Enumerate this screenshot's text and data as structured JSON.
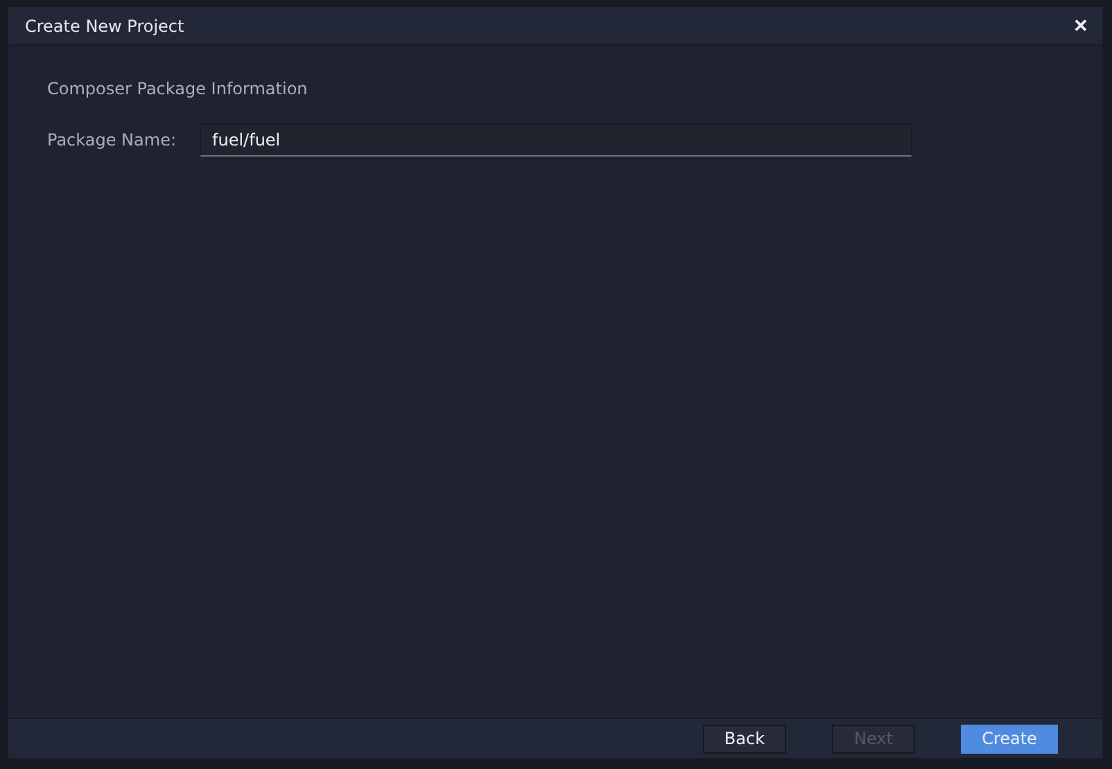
{
  "dialog": {
    "title": "Create New Project",
    "close": "✕"
  },
  "section": {
    "heading": "Composer Package Information"
  },
  "fields": [
    {
      "label": "Package Name:",
      "value": "fuel/fuel"
    }
  ],
  "buttons": [
    {
      "label": "Back",
      "kind": "default",
      "disabled": false
    },
    {
      "label": "Next",
      "kind": "default",
      "disabled": true
    },
    {
      "label": "Create",
      "kind": "primary",
      "disabled": false
    }
  ]
}
